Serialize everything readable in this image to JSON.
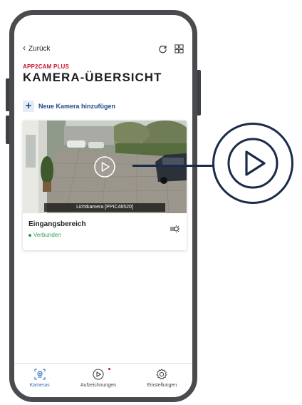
{
  "header": {
    "back_label": "Zurück",
    "brand": "APP2CAM PLUS",
    "title": "KAMERA-ÜBERSICHT",
    "refresh_icon": "refresh-icon",
    "grid_icon": "grid-view-icon"
  },
  "add_camera": {
    "label": "Neue Kamera hinzufügen",
    "icon": "plus-icon"
  },
  "camera": {
    "preview_label": "Lichtkamera [PPIC46520]",
    "name": "Eingangsbereich",
    "status": "Verbunden",
    "play_icon": "play-icon",
    "settings_icon": "camera-settings-icon"
  },
  "nav": {
    "items": [
      {
        "label": "Kameras",
        "icon": "camera-icon"
      },
      {
        "label": "Aufzeichnungen",
        "icon": "play-icon"
      },
      {
        "label": "Einstellungen",
        "icon": "gear-icon"
      }
    ]
  },
  "colors": {
    "brand_red": "#c8102e",
    "accent_blue": "#1e4a86",
    "status_green": "#2e9e4f",
    "frame": "#4a4b4e",
    "callout": "#1b2b4a"
  }
}
